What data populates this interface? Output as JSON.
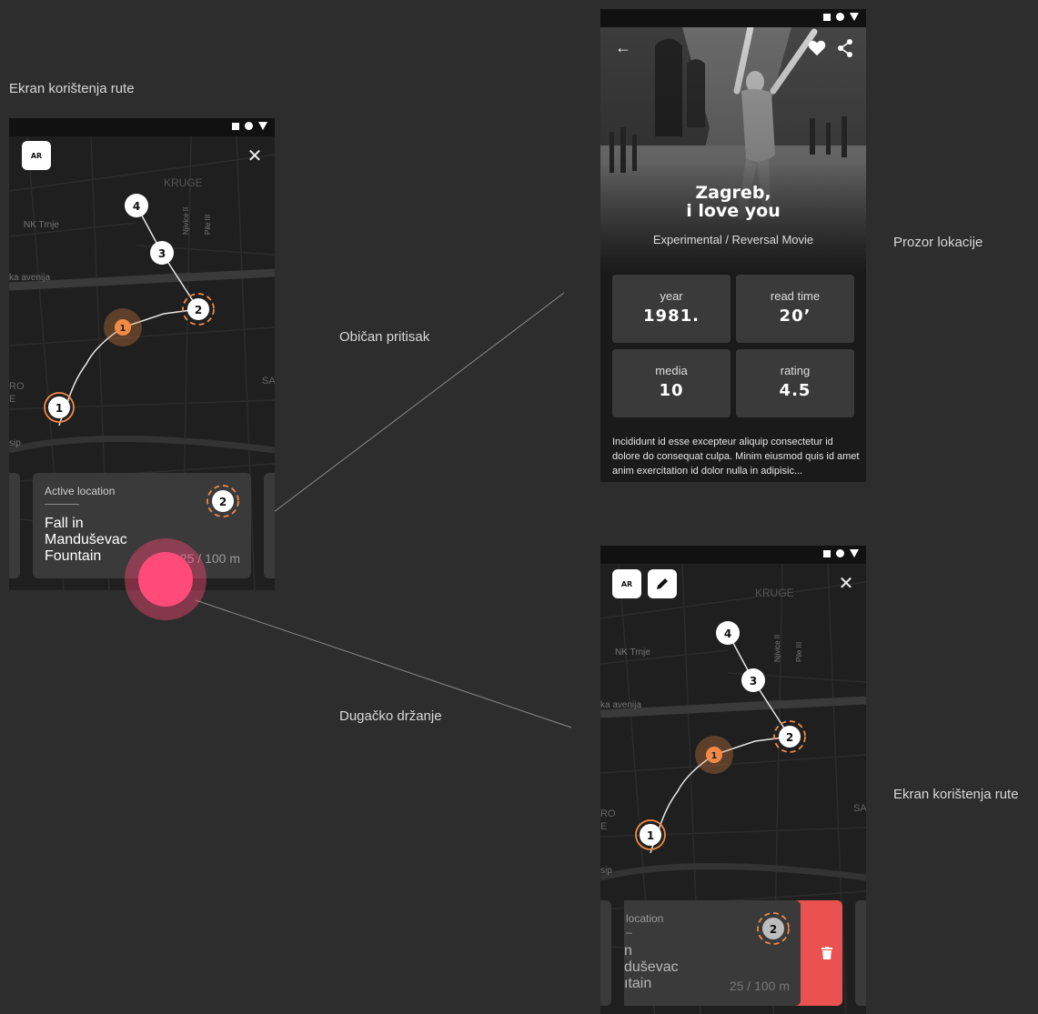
{
  "labels": {
    "left_screen": "Ekran korištenja rute",
    "tap": "Običan pritisak",
    "long_press": "Dugačko držanje",
    "location_window": "Prozor lokacije",
    "right_screen": "Ekran korištenja rute"
  },
  "map": {
    "ar_label": "AR",
    "close_glyph": "✕",
    "street_kruge": "KRUGE",
    "street_nk_trnje": "NK Trnje",
    "street_avenija": "ka avenija",
    "street_njivice": "Njivice II",
    "street_pile": "Pile III",
    "street_sip": "sip",
    "street_ro": "RO",
    "street_e": "E",
    "street_sa": "SA",
    "markers": [
      "1",
      "2",
      "3",
      "4"
    ],
    "user_marker": "1"
  },
  "card": {
    "active_label": "Active location",
    "title_lines": [
      "Fall in",
      "Manduševac",
      "Fountain"
    ],
    "distance": "25 / 100 m",
    "badge": "2"
  },
  "card_dragged": {
    "active_label": "location",
    "dash": "–",
    "title_lines": [
      "n",
      "duševac",
      "ıtain"
    ],
    "distance": "25 / 100 m",
    "badge": "2"
  },
  "detail": {
    "back_glyph": "←",
    "title_line1": "Zagreb,",
    "title_line2": "i love you",
    "subtitle": "Experimental / Reversal Movie",
    "stats": [
      {
        "label": "year",
        "value": "1981."
      },
      {
        "label": "read time",
        "value": "20’"
      },
      {
        "label": "media",
        "value": "10"
      },
      {
        "label": "rating",
        "value": "4.5"
      }
    ],
    "description": "Incididunt id esse excepteur aliquip consectetur id dolore do consequat culpa. Minim eiusmod quis id amet anim exercitation id dolor nulla in adipisic..."
  },
  "colors": {
    "background": "#2d2d2d",
    "marker_orange": "#f28a45",
    "touch_pink": "#ff4a7a",
    "delete_red": "#e9524f",
    "card": "#3a3a3a"
  },
  "icons": [
    "square-icon",
    "circle-icon",
    "triangle-icon",
    "close-icon",
    "pencil-icon",
    "back-arrow-icon",
    "heart-icon",
    "share-icon",
    "trash-icon",
    "navigation-arrow-icon"
  ]
}
